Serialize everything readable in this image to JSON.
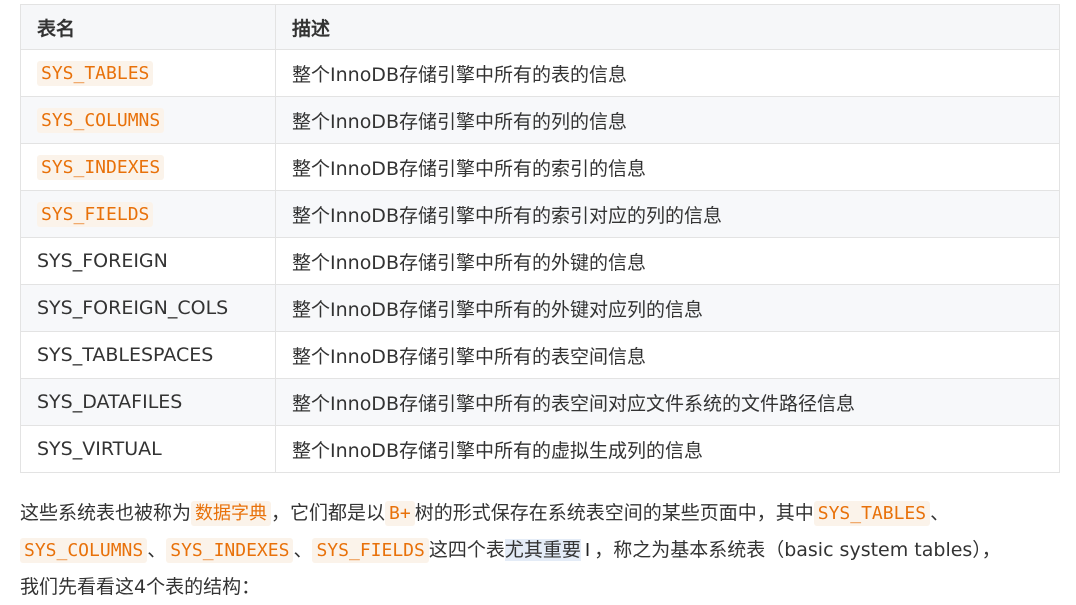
{
  "table": {
    "headers": [
      "表名",
      "描述"
    ],
    "rows": [
      {
        "name": "SYS_TABLES",
        "desc": "整个InnoDB存储引擎中所有的表的信息",
        "code": true
      },
      {
        "name": "SYS_COLUMNS",
        "desc": "整个InnoDB存储引擎中所有的列的信息",
        "code": true
      },
      {
        "name": "SYS_INDEXES",
        "desc": "整个InnoDB存储引擎中所有的索引的信息",
        "code": true
      },
      {
        "name": "SYS_FIELDS",
        "desc": "整个InnoDB存储引擎中所有的索引对应的列的信息",
        "code": true
      },
      {
        "name": "SYS_FOREIGN",
        "desc": "整个InnoDB存储引擎中所有的外键的信息",
        "code": false
      },
      {
        "name": "SYS_FOREIGN_COLS",
        "desc": "整个InnoDB存储引擎中所有的外键对应列的信息",
        "code": false
      },
      {
        "name": "SYS_TABLESPACES",
        "desc": "整个InnoDB存储引擎中所有的表空间信息",
        "code": false
      },
      {
        "name": "SYS_DATAFILES",
        "desc": "整个InnoDB存储引擎中所有的表空间对应文件系统的文件路径信息",
        "code": false
      },
      {
        "name": "SYS_VIRTUAL",
        "desc": "整个InnoDB存储引擎中所有的虚拟生成列的信息",
        "code": false
      }
    ]
  },
  "paragraph": {
    "t1": "这些系统表也被称为",
    "c1": "数据字典",
    "t2": "，它们都是以",
    "c2": "B+",
    "t3": "树的形式保存在系统表空间的某些页面中，其中",
    "c3": "SYS_TABLES",
    "t4": "、",
    "c4": "SYS_COLUMNS",
    "t5": "、",
    "c5": "SYS_INDEXES",
    "t6": "、",
    "c6": "SYS_FIELDS",
    "t7": "这四个表",
    "t8": "尤其重要",
    "t9": "，称之为基本系统表（basic system tables），",
    "t10": "我们先看看这4个表的结构："
  },
  "cursor_glyph": "I"
}
